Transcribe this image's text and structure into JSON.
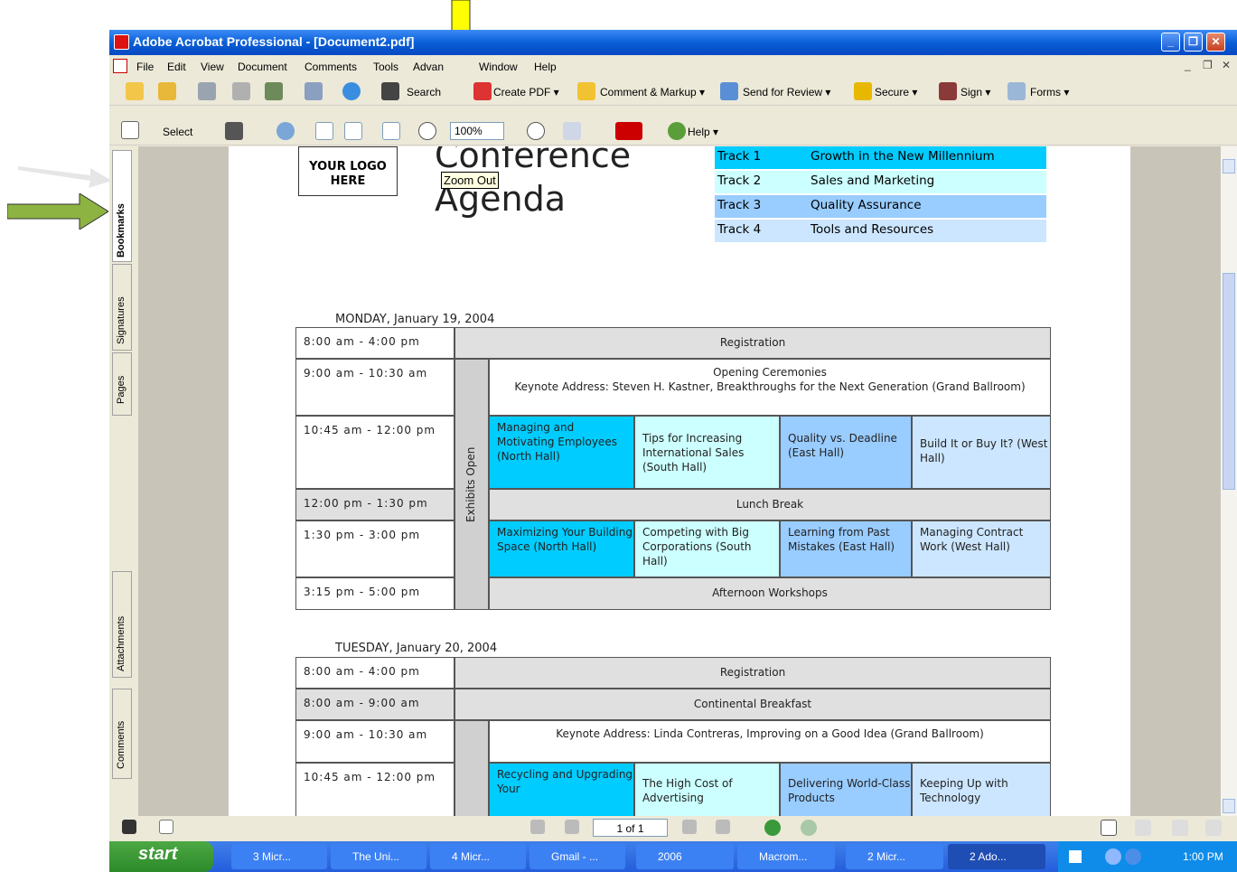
{
  "window": {
    "title": "Adobe Acrobat Professional - [Document2.pdf]",
    "minimize": "_",
    "restore": "❐",
    "close": "✕"
  },
  "menu": [
    "File",
    "Edit",
    "View",
    "Document",
    "Comments",
    "Tools",
    "Advan",
    "Window",
    "Help"
  ],
  "mdi": {
    "minimize": "_",
    "restore": "❐",
    "close": "✕"
  },
  "toolbar1": {
    "search": "Search",
    "create_pdf": "Create PDF ▾",
    "comment": "Comment & Markup ▾",
    "review": "Send for Review ▾",
    "secure": "Secure ▾",
    "sign": "Sign ▾",
    "forms": "Forms ▾"
  },
  "toolbar2": {
    "select": "Select",
    "zoom_value": "100%",
    "help": "Help ▾"
  },
  "tooltip": "Zoom Out",
  "side_tabs": [
    "Bookmarks",
    "Signatures",
    "Pages",
    "Attachments",
    "Comments"
  ],
  "doc": {
    "logo": "YOUR LOGO\nHERE",
    "title_line1": "Conference",
    "title_line2": "Agenda",
    "tracks": [
      {
        "num": "Track 1",
        "name": "Growth in the New Millennium"
      },
      {
        "num": "Track 2",
        "name": "Sales and Marketing"
      },
      {
        "num": "Track 3",
        "name": "Quality Assurance"
      },
      {
        "num": "Track 4",
        "name": "Tools and Resources"
      }
    ],
    "day1": {
      "label": "MONDAY, January 19, 2004",
      "exhibits": "Exhibits Open",
      "times": [
        "8:00 am - 4:00 pm",
        "9:00 am - 10:30 am",
        "10:45 am - 12:00 pm",
        "12:00 pm - 1:30 pm",
        "1:30 pm - 3:00 pm",
        "3:15 pm - 5:00 pm"
      ],
      "registration": "Registration",
      "opening": "Opening Ceremonies\nKeynote Address: Steven H. Kastner, Breakthroughs for the Next Generation (Grand Ballroom)",
      "sessions_am": [
        "Managing and Motivating Employees (North Hall)",
        "Tips for Increasing International Sales (South Hall)",
        "Quality vs. Deadline (East Hall)",
        "Build It or Buy It? (West Hall)"
      ],
      "lunch": "Lunch Break",
      "sessions_pm": [
        "Maximizing Your Building Space (North Hall)",
        "Competing with Big Corporations (South Hall)",
        "Learning from Past Mistakes (East Hall)",
        "Managing Contract Work (West Hall)"
      ],
      "afternoon": "Afternoon Workshops"
    },
    "day2": {
      "label": "TUESDAY, January 20, 2004",
      "times": [
        "8:00 am - 4:00 pm",
        "8:00 am - 9:00 am",
        "9:00 am - 10:30 am",
        "10:45 am - 12:00 pm"
      ],
      "registration": "Registration",
      "breakfast": "Continental Breakfast",
      "keynote": "Keynote Address: Linda Contreras, Improving on a Good Idea (Grand Ballroom)",
      "sessions": [
        "Recycling and Upgrading Your",
        "The High Cost of Advertising",
        "Delivering World-Class Products",
        "Keeping Up with Technology"
      ]
    }
  },
  "status": {
    "page": "1 of 1"
  },
  "taskbar": {
    "start": "start",
    "tasks": [
      "3 Micr...",
      "The Uni...",
      "4 Micr...",
      "Gmail - ...",
      "2006",
      "Macrom...",
      "2 Micr...",
      "2 Ado..."
    ],
    "clock": "1:00 PM"
  },
  "colors": {
    "track1": "#00ccff",
    "track2": "#ccffff",
    "track3": "#99ccff",
    "track4": "#cce6ff",
    "arrow_yellow": "#ffff00",
    "arrow_green": "#8db342"
  }
}
